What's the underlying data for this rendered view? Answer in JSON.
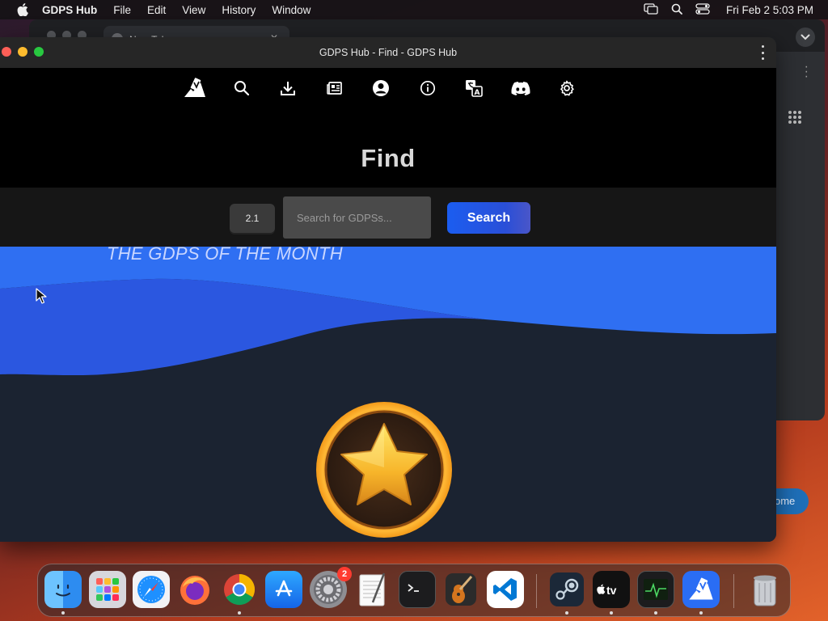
{
  "menubar": {
    "app_name": "GDPS Hub",
    "menus": [
      "File",
      "Edit",
      "View",
      "History",
      "Window"
    ],
    "clock": "Fri Feb 2  5:03 PM"
  },
  "background_window": {
    "tab_title": "New Tab",
    "home_button": "ome"
  },
  "window": {
    "title": "GDPS Hub - Find - GDPS Hub"
  },
  "nav": {
    "icons": [
      "gdps-hub-logo-icon",
      "search-icon",
      "download-icon",
      "news-icon",
      "account-icon",
      "info-icon",
      "translate-icon",
      "discord-icon",
      "settings-icon"
    ]
  },
  "page": {
    "title": "Find"
  },
  "search": {
    "version_label": "2.1",
    "placeholder": "Search for GDPSs...",
    "button_label": "Search"
  },
  "featured": {
    "heading": "THE GDPS OF THE MONTH"
  },
  "dock": {
    "apps": [
      "Finder",
      "Launchpad",
      "Safari",
      "Firefox",
      "Chrome",
      "App Store",
      "System Settings",
      "TextEdit",
      "Terminal",
      "GarageBand",
      "Visual Studio Code",
      "Steam",
      "Apple TV",
      "Activity Monitor",
      "GDPS Hub",
      "Trash"
    ],
    "system_settings_badge": "2"
  },
  "colors": {
    "accent_blue": "#1b5df0",
    "wave_light": "#2f6ff2",
    "wave_dark": "#2b57e0",
    "medal_gold": "#f7a928"
  }
}
